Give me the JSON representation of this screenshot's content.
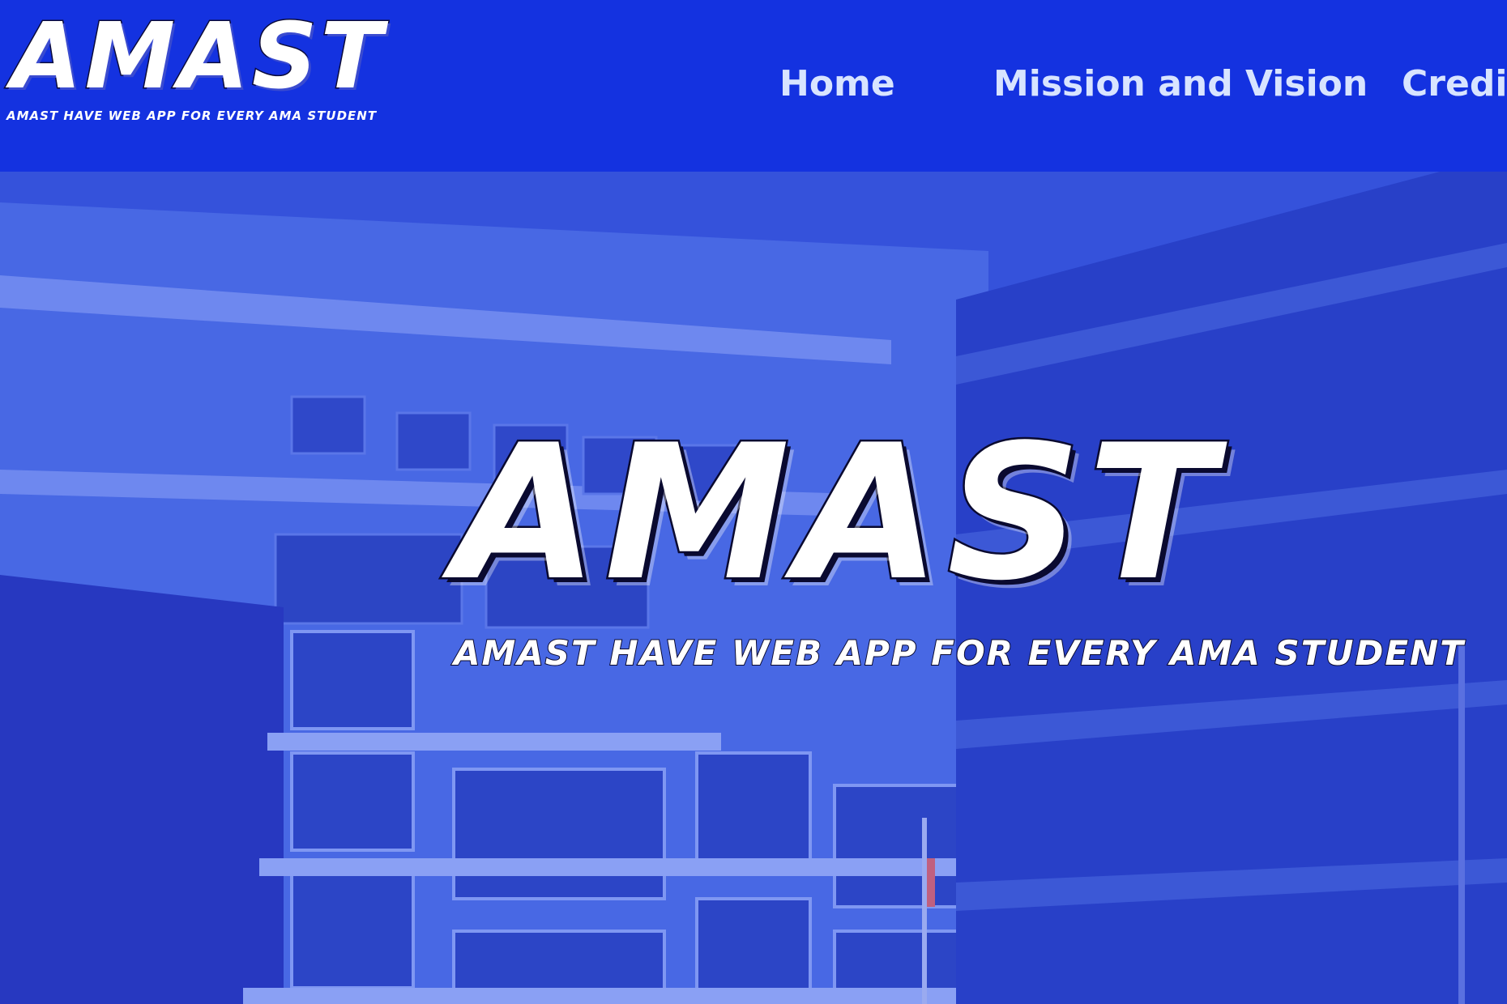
{
  "header": {
    "logo": {
      "word": "AMAST",
      "tagline": "AMAST HAVE WEB APP FOR EVERY AMA STUDENT"
    },
    "nav": [
      {
        "label": "Home"
      },
      {
        "label": "Mission and Vision"
      },
      {
        "label": "Credits"
      }
    ]
  },
  "hero": {
    "title": "AMAST",
    "subtitle": "AMAST HAVE WEB APP FOR EVERY AMA STUDENT"
  },
  "colors": {
    "header_bg": "#1432e0",
    "hero_tint": "#2a44d6",
    "nav_text": "#d8e4ff",
    "logo_fill": "#ffffff"
  }
}
